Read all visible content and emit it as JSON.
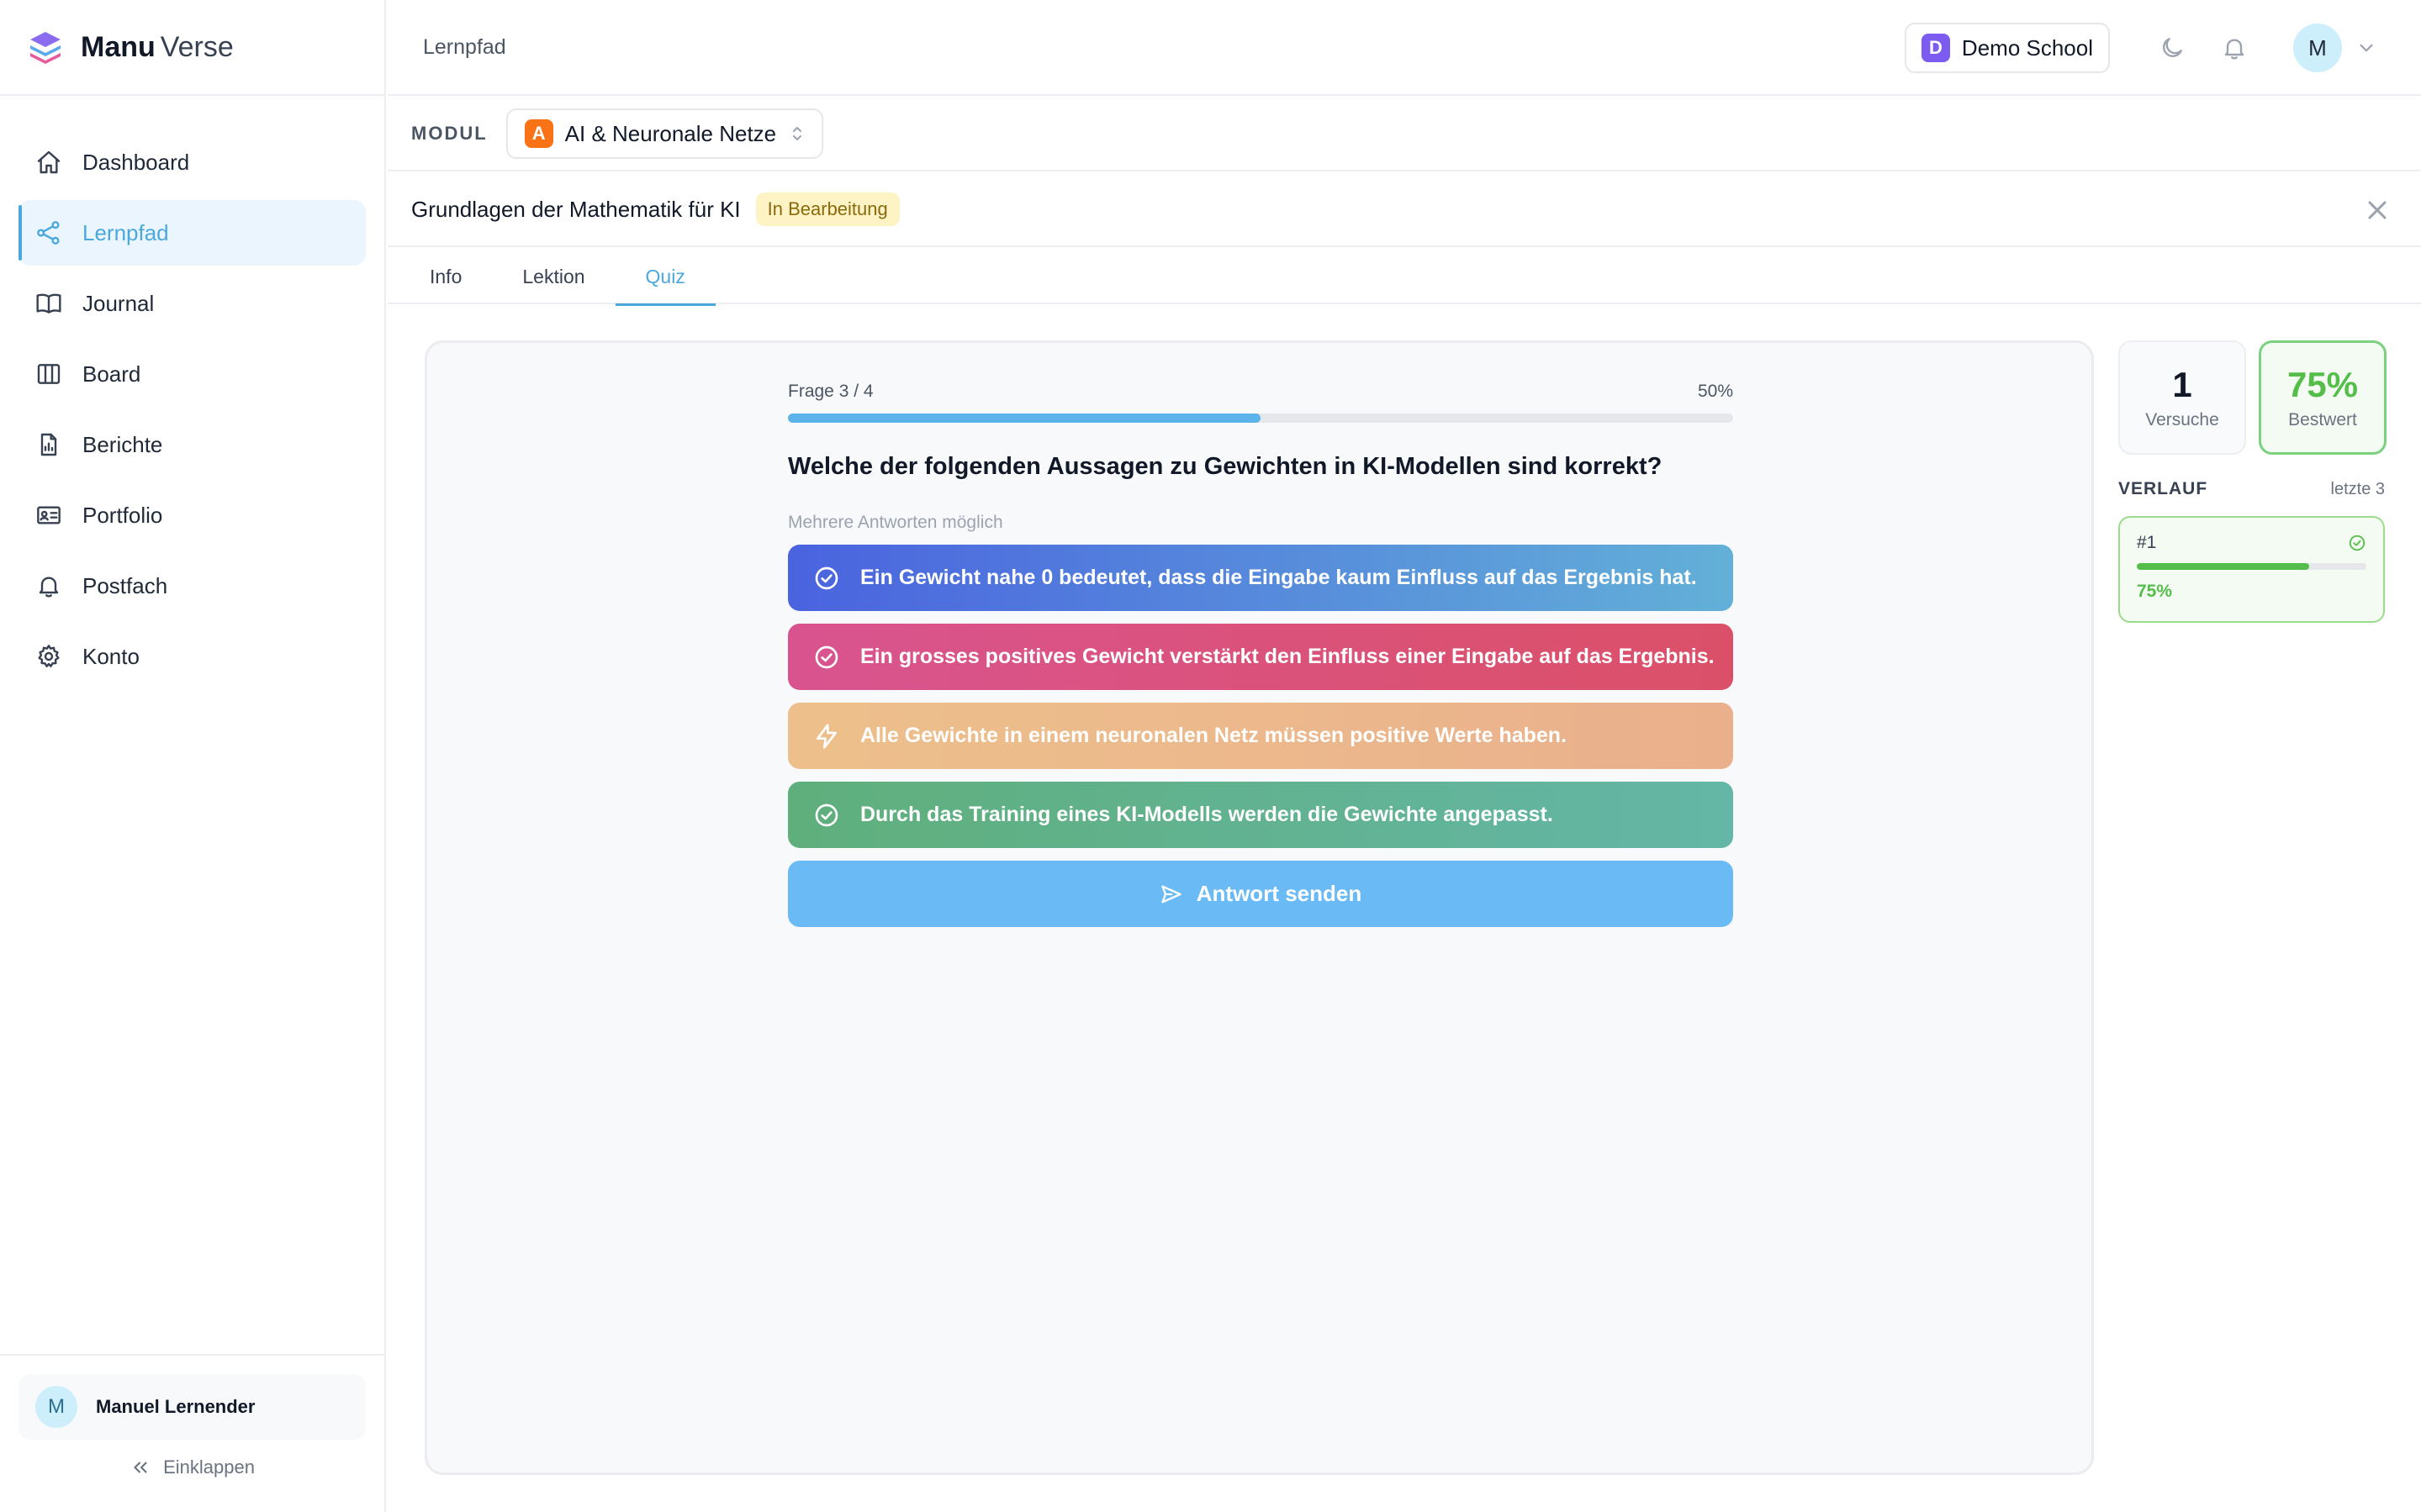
{
  "brand": {
    "name_bold": "Manu",
    "name_light": "Verse"
  },
  "sidebar": {
    "items": [
      {
        "label": "Dashboard",
        "icon": "home-icon",
        "active": false
      },
      {
        "label": "Lernpfad",
        "icon": "share-nodes-icon",
        "active": true
      },
      {
        "label": "Journal",
        "icon": "book-open-icon",
        "active": false
      },
      {
        "label": "Board",
        "icon": "columns-icon",
        "active": false
      },
      {
        "label": "Berichte",
        "icon": "file-chart-icon",
        "active": false
      },
      {
        "label": "Portfolio",
        "icon": "id-card-icon",
        "active": false
      },
      {
        "label": "Postfach",
        "icon": "bell-icon",
        "active": false
      },
      {
        "label": "Konto",
        "icon": "gear-icon",
        "active": false
      }
    ],
    "user": {
      "initial": "M",
      "name": "Manuel Lernender"
    },
    "collapse_label": "Einklappen"
  },
  "header": {
    "breadcrumb": "Lernpfad",
    "school": {
      "initial": "D",
      "name": "Demo School",
      "color": "#7c5cf0"
    },
    "user_initial": "M"
  },
  "module": {
    "label": "MODUL",
    "selected": {
      "initial": "A",
      "name": "AI & Neuronale Netze",
      "color": "#f97316"
    }
  },
  "lesson": {
    "title": "Grundlagen der Mathematik für KI",
    "status": "In Bearbeitung"
  },
  "tabs": [
    {
      "label": "Info",
      "active": false
    },
    {
      "label": "Lektion",
      "active": false
    },
    {
      "label": "Quiz",
      "active": true
    }
  ],
  "quiz": {
    "progress_label": "Frage 3 / 4",
    "progress_percent_label": "50%",
    "progress_fraction": 0.5,
    "question": "Welche der folgenden Aussagen zu Gewichten in KI-Modellen sind korrekt?",
    "hint": "Mehrere Antworten möglich",
    "answers": [
      {
        "text": "Ein Gewicht nahe 0 bedeutet, dass die Eingabe kaum Einfluss auf das Ergebnis hat.",
        "icon": "check-circle-icon"
      },
      {
        "text": "Ein grosses positives Gewicht verstärkt den Einfluss einer Eingabe auf das Ergebnis.",
        "icon": "check-circle-icon"
      },
      {
        "text": "Alle Gewichte in einem neuronalen Netz müssen positive Werte haben.",
        "icon": "lightning-icon"
      },
      {
        "text": "Durch das Training eines KI-Modells werden die Gewichte angepasst.",
        "icon": "check-circle-icon"
      }
    ],
    "submit_label": "Antwort senden"
  },
  "stats": {
    "attempts_value": "1",
    "attempts_label": "Versuche",
    "best_value": "75%",
    "best_label": "Bestwert",
    "accent_color": "#55be4a"
  },
  "history": {
    "title": "VERLAUF",
    "subtitle": "letzte 3",
    "entries": [
      {
        "number": "#1",
        "score_label": "75%",
        "score_fraction": 0.75
      }
    ]
  }
}
